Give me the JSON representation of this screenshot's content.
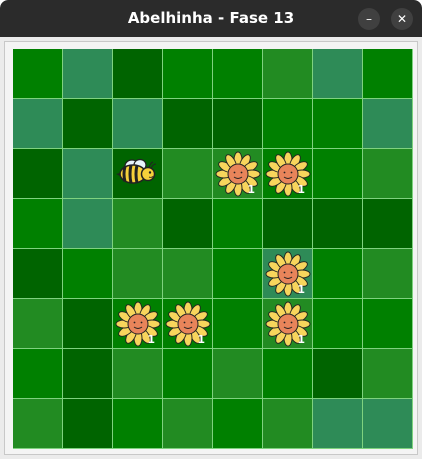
{
  "window": {
    "title": "Abelhinha - Fase 13",
    "minimize_glyph": "–",
    "close_glyph": "✕"
  },
  "board": {
    "rows": 8,
    "cols": 8,
    "palette": {
      "c0": "#008000",
      "c1": "#2e8b57",
      "c2": "#006400",
      "c3": "#228b22",
      "grid_line": "#7fd27f"
    },
    "cells": [
      [
        "c0",
        "c1",
        "c2",
        "c0",
        "c0",
        "c3",
        "c1",
        "c0"
      ],
      [
        "c1",
        "c2",
        "c1",
        "c2",
        "c2",
        "c0",
        "c0",
        "c1"
      ],
      [
        "c2",
        "c1",
        "c2",
        "c3",
        "c3",
        "c0",
        "c0",
        "c3"
      ],
      [
        "c0",
        "c1",
        "c3",
        "c2",
        "c0",
        "c2",
        "c2",
        "c2"
      ],
      [
        "c2",
        "c0",
        "c3",
        "c3",
        "c0",
        "c1",
        "c0",
        "c3"
      ],
      [
        "c3",
        "c2",
        "c0",
        "c0",
        "c0",
        "c3",
        "c0",
        "c0"
      ],
      [
        "c0",
        "c2",
        "c3",
        "c0",
        "c3",
        "c0",
        "c2",
        "c3"
      ],
      [
        "c3",
        "c2",
        "c0",
        "c3",
        "c0",
        "c3",
        "c1",
        "c1"
      ]
    ],
    "bee": {
      "row": 2,
      "col": 2,
      "icon": "bee-icon"
    },
    "flowers": [
      {
        "row": 2,
        "col": 4,
        "count": "1",
        "icon": "sunflower-icon"
      },
      {
        "row": 2,
        "col": 5,
        "count": "1",
        "icon": "sunflower-icon"
      },
      {
        "row": 4,
        "col": 5,
        "count": "1",
        "icon": "sunflower-icon"
      },
      {
        "row": 5,
        "col": 2,
        "count": "1",
        "icon": "sunflower-icon"
      },
      {
        "row": 5,
        "col": 3,
        "count": "1",
        "icon": "sunflower-icon"
      },
      {
        "row": 5,
        "col": 5,
        "count": "1",
        "icon": "sunflower-icon"
      }
    ]
  }
}
